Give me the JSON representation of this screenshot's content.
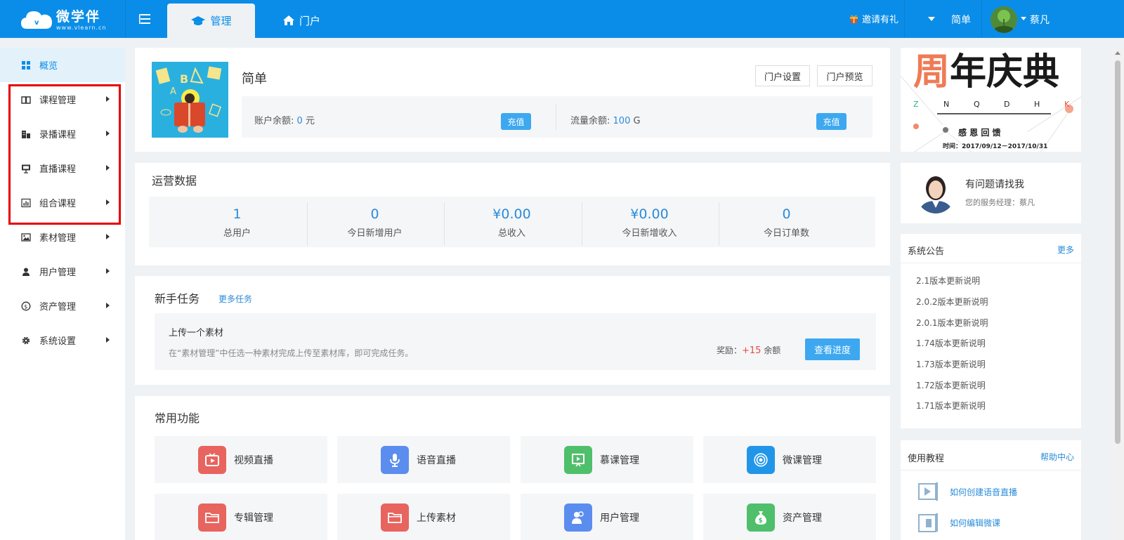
{
  "header": {
    "logo_title": "微学伴",
    "logo_sub": "www.vlearn.cn",
    "tab_manage": "管理",
    "tab_portal": "门户",
    "invite": "邀请有礼",
    "dropdown_label": "简单",
    "user_name": "蔡凡"
  },
  "sidebar": {
    "items": [
      {
        "label": "概览",
        "icon": "grid-icon"
      },
      {
        "label": "课程管理",
        "icon": "book-icon"
      },
      {
        "label": "录播课程",
        "icon": "building-icon"
      },
      {
        "label": "直播课程",
        "icon": "presentation-icon"
      },
      {
        "label": "组合课程",
        "icon": "bar-chart-icon"
      },
      {
        "label": "素材管理",
        "icon": "image-icon"
      },
      {
        "label": "用户管理",
        "icon": "user-icon"
      },
      {
        "label": "资产管理",
        "icon": "coin-icon"
      },
      {
        "label": "系统设置",
        "icon": "gear-icon"
      }
    ]
  },
  "org": {
    "name": "简单",
    "portal_settings": "门户设置",
    "portal_preview": "门户预览",
    "balance_label": "账户余额:",
    "balance_value": "0",
    "balance_unit": "元",
    "recharge": "充值",
    "traffic_label": "流量余额:",
    "traffic_value": "100",
    "traffic_unit": "G"
  },
  "ops": {
    "title": "运营数据",
    "stats": [
      {
        "value": "1",
        "label": "总用户"
      },
      {
        "value": "0",
        "label": "今日新增用户"
      },
      {
        "value": "¥0.00",
        "label": "总收入"
      },
      {
        "value": "¥0.00",
        "label": "今日新增收入"
      },
      {
        "value": "0",
        "label": "今日订单数"
      }
    ]
  },
  "tasks": {
    "title": "新手任务",
    "more": "更多任务",
    "task_title": "上传一个素材",
    "task_desc": "在“素材管理”中任选一种素材完成上传至素材库，即可完成任务。",
    "reward_label": "奖励：",
    "reward_value": "+15",
    "reward_unit": "余额",
    "progress_button": "查看进度"
  },
  "functions": {
    "title": "常用功能",
    "items": [
      {
        "label": "视频直播",
        "color": "#e8645f"
      },
      {
        "label": "语音直播",
        "color": "#5b8def"
      },
      {
        "label": "慕课管理",
        "color": "#4fbf6b"
      },
      {
        "label": "微课管理",
        "color": "#2196e8"
      },
      {
        "label": "专辑管理",
        "color": "#e8645f"
      },
      {
        "label": "上传素材",
        "color": "#e8645f"
      },
      {
        "label": "用户管理",
        "color": "#5b8def"
      },
      {
        "label": "资产管理",
        "color": "#4fbf6b"
      }
    ]
  },
  "banner": {
    "title_first": "周",
    "title_rest": "年庆典",
    "letters": [
      "Z",
      "N",
      "Q",
      "D",
      "H",
      "K"
    ],
    "subtitle": "感 恩 回 馈",
    "time": "时间：2017/09/12－2017/10/31"
  },
  "contact": {
    "title": "有问题请找我",
    "sub": "您的服务经理：蔡凡"
  },
  "notices": {
    "title": "系统公告",
    "more": "更多",
    "items": [
      "2.1版本更新说明",
      "2.0.2版本更新说明",
      "2.0.1版本更新说明",
      "1.74版本更新说明",
      "1.73版本更新说明",
      "1.72版本更新说明",
      "1.71版本更新说明"
    ]
  },
  "tutorials": {
    "title": "使用教程",
    "more": "帮助中心",
    "items": [
      "如何创建语音直播",
      "如何编辑微课"
    ]
  },
  "colors": {
    "brand": "#0a8de8",
    "link": "#2a8bd8",
    "reward": "#e84c3d",
    "highlight": "#e60000"
  }
}
